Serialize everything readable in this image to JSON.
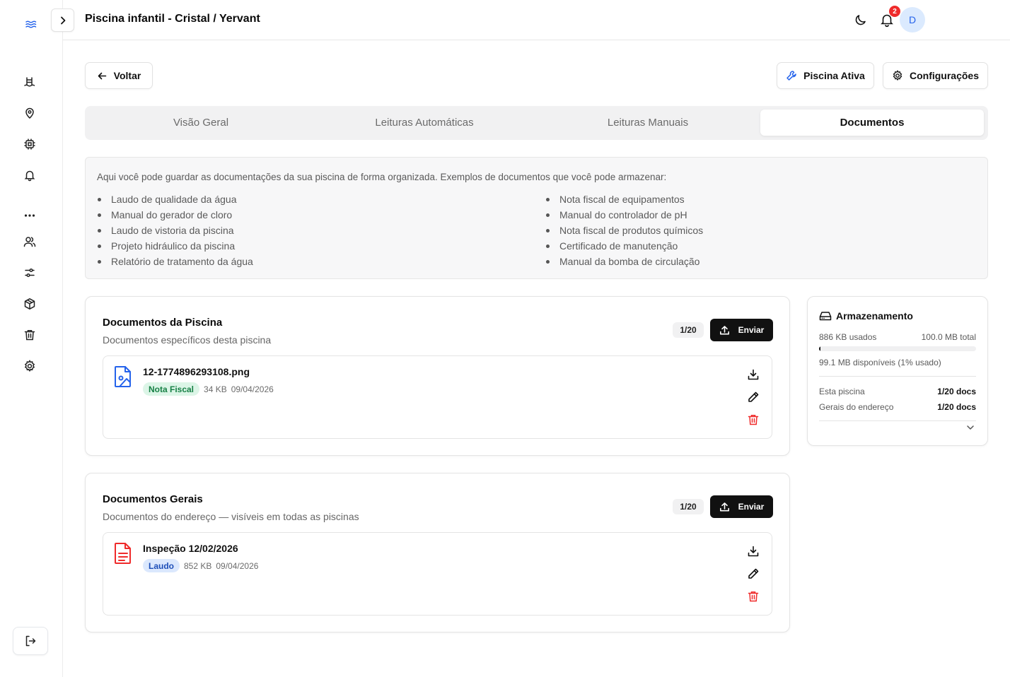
{
  "header": {
    "title": "Piscina infantil - Cristal / Yervant",
    "notification_count": "2",
    "avatar_initial": "D"
  },
  "toolbar": {
    "back_label": "Voltar",
    "active_label": "Piscina Ativa",
    "config_label": "Configurações"
  },
  "tabs": [
    {
      "label": "Visão Geral"
    },
    {
      "label": "Leituras Automáticas"
    },
    {
      "label": "Leituras Manuais"
    },
    {
      "label": "Documentos"
    }
  ],
  "info": {
    "text": "Aqui você pode guardar as documentações da sua piscina de forma organizada. Exemplos de documentos que você pode armazenar:",
    "left": [
      "Laudo de qualidade da água",
      "Manual do gerador de cloro",
      "Laudo de vistoria da piscina",
      "Projeto hidráulico da piscina",
      "Relatório de tratamento da água"
    ],
    "right": [
      "Nota fiscal de equipamentos",
      "Manual do controlador de pH",
      "Nota fiscal de produtos químicos",
      "Certificado de manutenção",
      "Manual da bomba de circulação"
    ]
  },
  "pool_docs": {
    "title": "Documentos da Piscina",
    "subtitle": "Documentos específicos desta piscina",
    "count": "1/20",
    "send_label": "Enviar",
    "item": {
      "name": "12-1774896293108.png",
      "tag": "Nota Fiscal",
      "size": "34 KB",
      "date": "09/04/2026"
    }
  },
  "general_docs": {
    "title": "Documentos Gerais",
    "subtitle": "Documentos do endereço — visíveis em todas as piscinas",
    "count": "1/20",
    "send_label": "Enviar",
    "item": {
      "name": "Inspeção 12/02/2026",
      "tag": "Laudo",
      "size": "852 KB",
      "date": "09/04/2026"
    }
  },
  "storage": {
    "title": "Armazenamento",
    "used": "886 KB usados",
    "total": "100.0 MB total",
    "used_fraction": 0.01,
    "available": "99.1 MB disponíveis (1% usado)",
    "pool_label": "Esta piscina",
    "pool_value": "1/20 docs",
    "general_label": "Gerais do endereço",
    "general_value": "1/20 docs"
  },
  "colors": {
    "accent": "#2563eb",
    "danger": "#ef2b2b",
    "primary": "#111111"
  }
}
